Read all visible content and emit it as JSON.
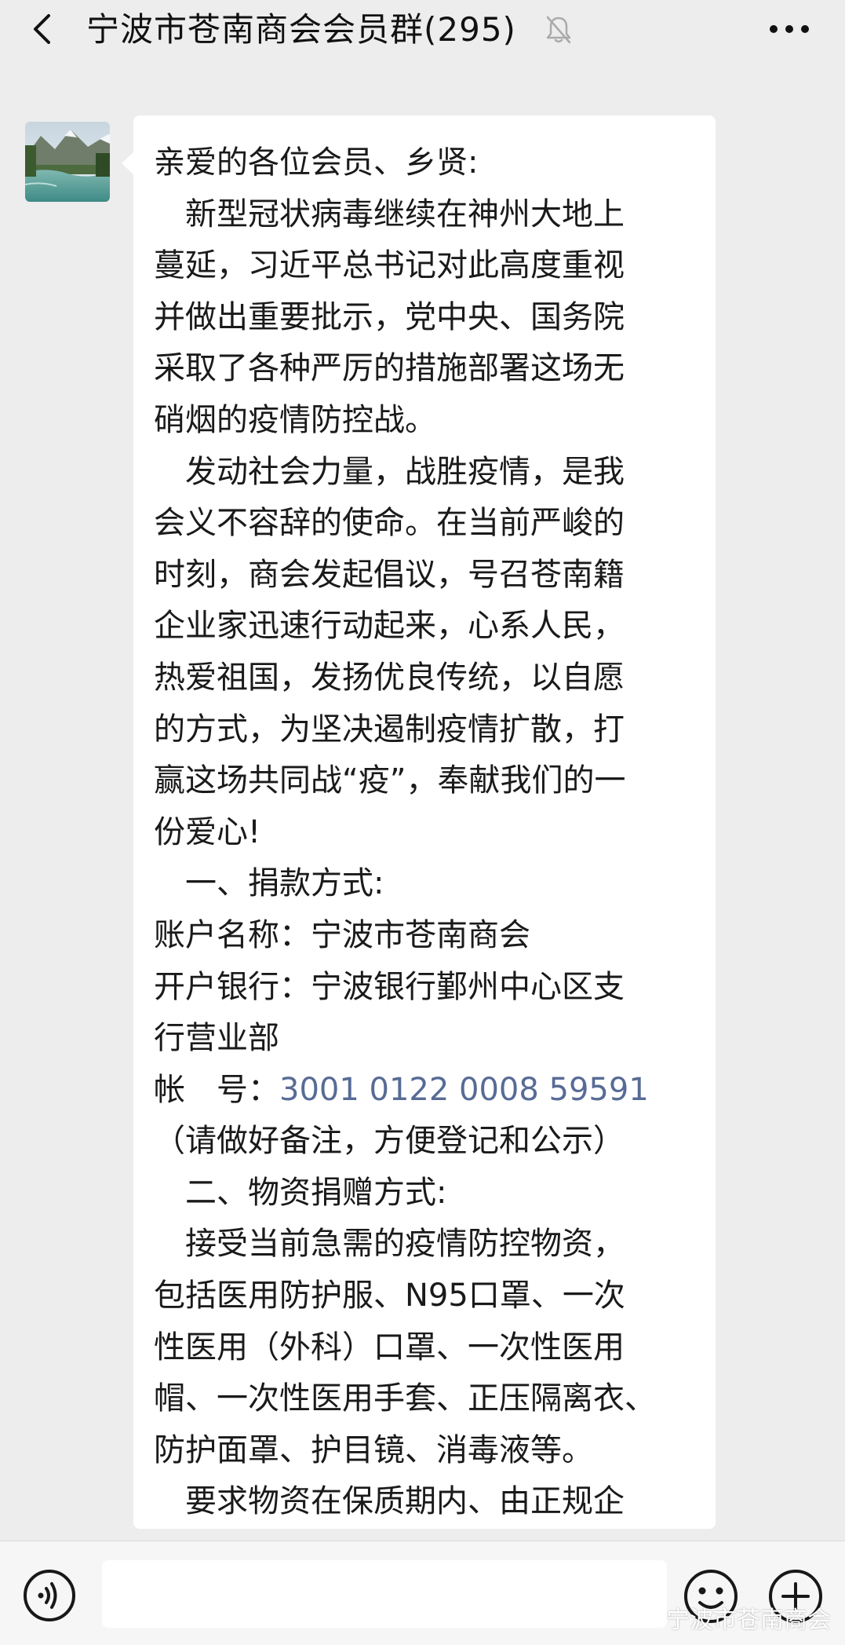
{
  "header": {
    "title": "宁波市苍南商会会员群(295)",
    "muted_icon": "bell-muted-icon",
    "back_icon": "chevron-left-icon",
    "more_icon": "more-dots-icon"
  },
  "message": {
    "lines": [
      "亲爱的各位会员、乡贤:",
      "　新型冠状病毒继续在神州大地上",
      "蔓延，习近平总书记对此高度重视",
      "并做出重要批示，党中央、国务院",
      "采取了各种严厉的措施部署这场无",
      "硝烟的疫情防控战。",
      "　发动社会力量，战胜疫情，是我",
      "会义不容辞的使命。在当前严峻的",
      "时刻，商会发起倡议，号召苍南籍",
      "企业家迅速行动起来，心系人民，",
      "热爱祖国，发扬优良传统，以自愿",
      "的方式，为坚决遏制疫情扩散，打",
      "赢这场共同战“疫”，奉献我们的一",
      "份爱心!",
      "　一、捐款方式:",
      "账户名称：宁波市苍南商会",
      "开户银行：宁波银行鄞州中心区支",
      "行营业部"
    ],
    "account_label": "帐　号：",
    "account_number": "3001 0122 0008 59591",
    "lines_after": [
      "（请做好备注，方便登记和公示）",
      "　二、物资捐赠方式:",
      "　接受当前急需的疫情防控物资，",
      "包括医用防护服、N95口罩、一次",
      "性医用（外科）口罩、一次性医用",
      "帽、一次性医用手套、正压隔离衣、",
      "防护面罩、护目镜、消毒液等。",
      "　要求物资在保质期内、由正规企"
    ]
  },
  "input_bar": {
    "voice_icon": "voice-icon",
    "emoji_icon": "emoji-icon",
    "plus_icon": "plus-icon"
  },
  "watermark": {
    "text": "宁波市苍南商会",
    "icon": "wechat-icon"
  }
}
